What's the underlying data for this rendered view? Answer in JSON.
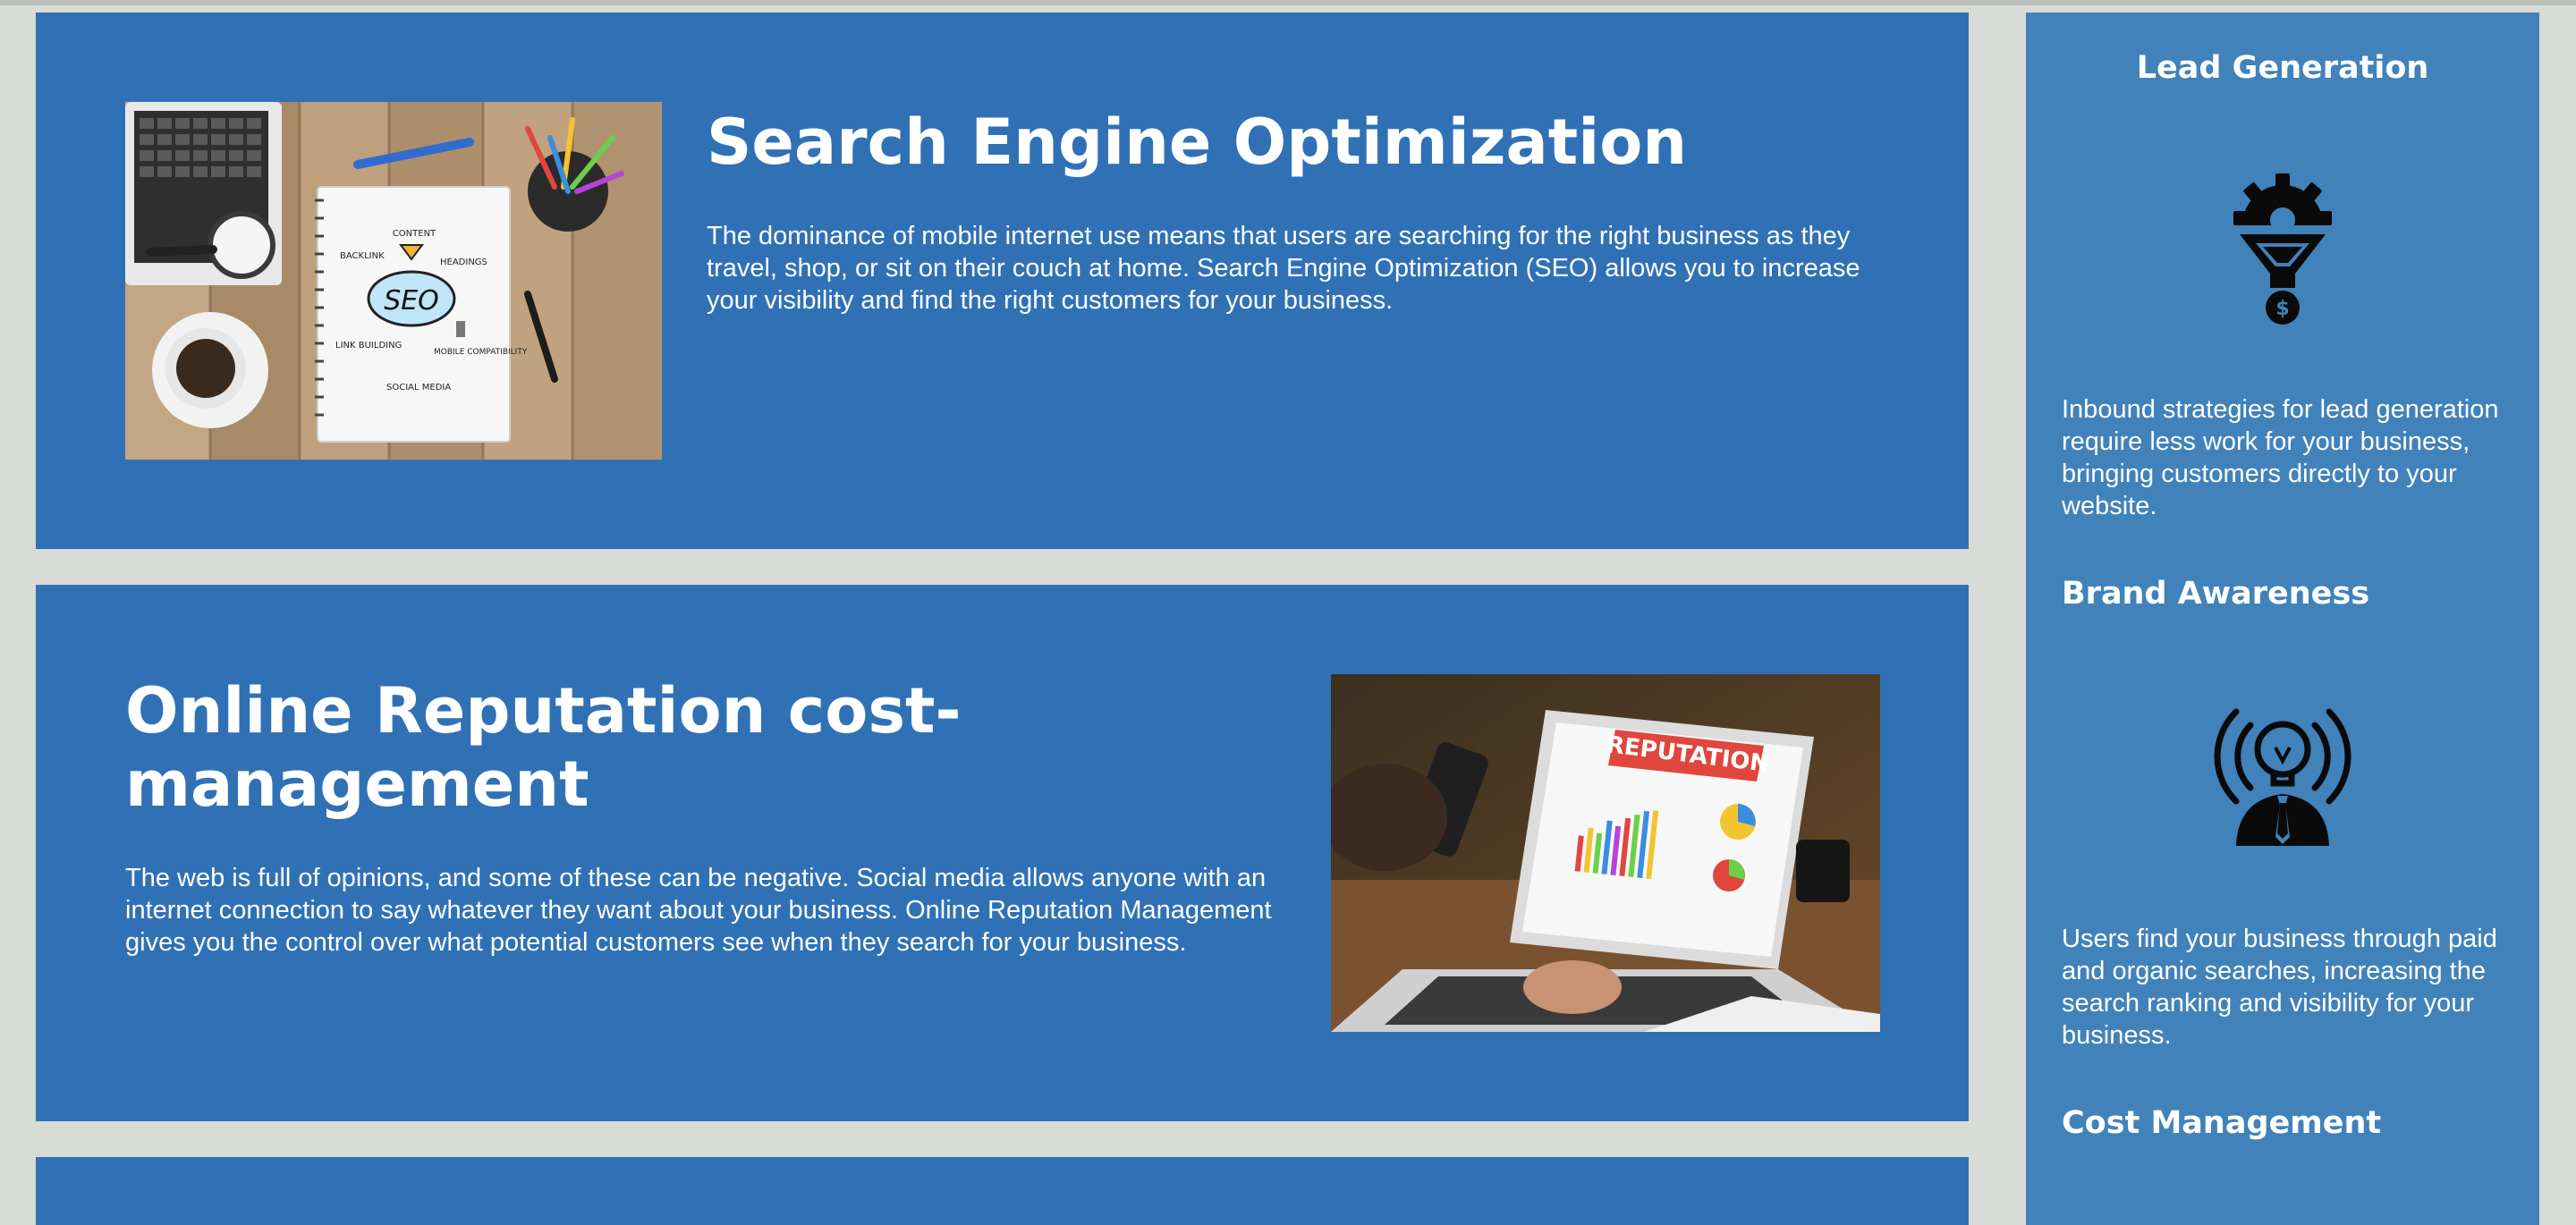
{
  "services": {
    "seo": {
      "title": "Search Engine Optimization",
      "body": "The dominance of mobile internet use means that users are searching for the right business as they travel, shop, or sit on their couch at home. Search Engine Optimization (SEO) allows you to increase your visibility and find the right customers for your business.",
      "image": {
        "notebook_center": "SEO",
        "labels": [
          "CONTENT",
          "BACKLINK",
          "HEADINGS",
          "LINK BUILDING",
          "MOBILE COMPATIBILITY",
          "SOCIAL MEDIA"
        ]
      }
    },
    "orm": {
      "title": "Online Reputation cost-management",
      "body": "The web is full of opinions, and some of these can be negative. Social media allows anyone with an internet connection to say whatever they want about your business. Online Reputation Management gives you the control over what potential customers see when they search for your business.",
      "image": {
        "screen_banner": "REPUTATION"
      }
    }
  },
  "benefits": {
    "lead": {
      "title": "Lead Generation",
      "icon": "lead-funnel-icon",
      "body": "Inbound strategies for lead generation require less work for your business, bringing customers directly to your website."
    },
    "brand": {
      "title": "Brand Awareness",
      "icon": "brand-lightbulb-icon",
      "body": "Users find your business through paid and organic searches, increasing the search ranking and visibility for your business."
    },
    "cost": {
      "title": "Cost Management"
    }
  },
  "colors": {
    "page_bg": "#d9dbd6",
    "card_bg": "#3071b6",
    "aside_bg": "#4182ba",
    "text": "#ffffff"
  }
}
